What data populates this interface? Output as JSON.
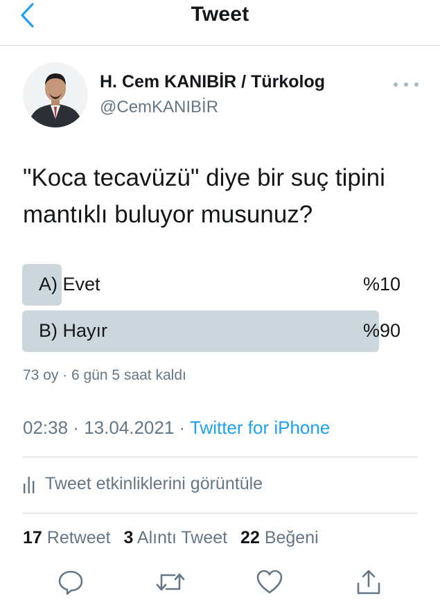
{
  "header": {
    "title": "Tweet"
  },
  "author": {
    "name": "H. Cem KANIBİR / Türkolog",
    "handle": "@CemKANIBİR"
  },
  "tweet": {
    "text_line1": "\"Koca tecavüzü\" diye bir suç tipini",
    "text_line2": "mantıklı buluyor musunuz?"
  },
  "poll": {
    "options": [
      {
        "label": "A) Evet",
        "percent_text": "%10",
        "percent": 10
      },
      {
        "label": "B) Hayır",
        "percent_text": "%90",
        "percent": 90
      }
    ],
    "votes": "73 oy",
    "separator": " · ",
    "remaining": "6 gün 5 saat kaldı"
  },
  "meta": {
    "time": "02:38",
    "separator": " · ",
    "date": "13.04.2021",
    "separator2": " · ",
    "source": "Twitter for iPhone"
  },
  "activity": {
    "label": "Tweet etkinliklerini görüntüle"
  },
  "stats": {
    "retweets_count": "17",
    "retweets_label": "Retweet",
    "quotes_count": "3",
    "quotes_label": "Alıntı Tweet",
    "likes_count": "22",
    "likes_label": "Beğeni"
  },
  "colors": {
    "accent": "#1da1f2",
    "secondary_text": "#657786",
    "poll_fill": "#ccd6dd",
    "divider": "#d6d9db"
  },
  "icons": [
    "chevron-left-icon",
    "more-icon",
    "analytics-icon",
    "reply-icon",
    "retweet-icon",
    "like-icon",
    "share-icon"
  ]
}
